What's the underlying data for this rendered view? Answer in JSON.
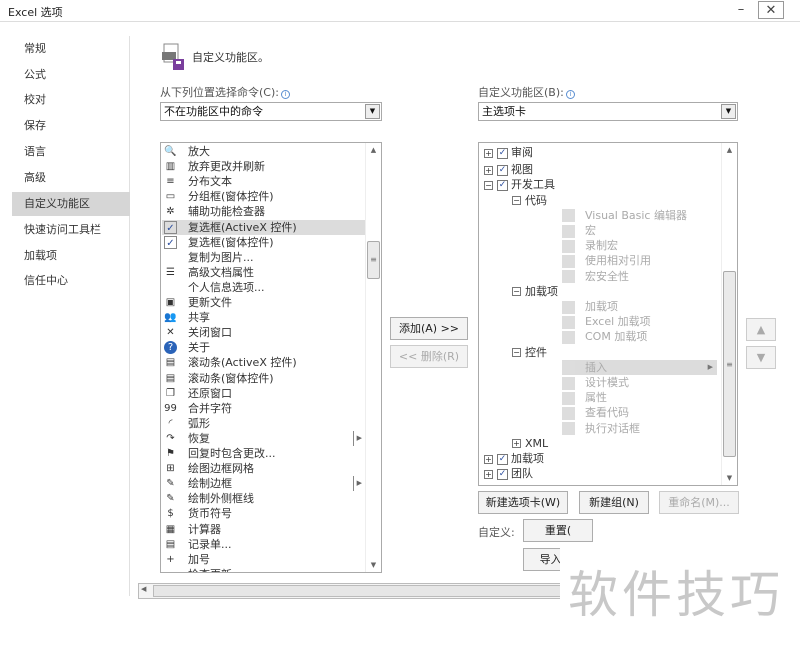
{
  "window": {
    "title": "Excel 选项",
    "minimize": "–",
    "close": "✕"
  },
  "sidebar": {
    "items": [
      {
        "label": "常规"
      },
      {
        "label": "公式"
      },
      {
        "label": "校对"
      },
      {
        "label": "保存"
      },
      {
        "label": "语言"
      },
      {
        "label": "高级"
      },
      {
        "label": "自定义功能区",
        "selected": true
      },
      {
        "label": "快速访问工具栏"
      },
      {
        "label": "加载项"
      },
      {
        "label": "信任中心"
      }
    ]
  },
  "header": {
    "title": "自定义功能区。",
    "icon": "customize-ribbon-icon"
  },
  "left": {
    "label": "从下列位置选择命令(C):",
    "combo_value": "不在功能区中的命令",
    "commands": [
      {
        "label": "放大",
        "icon": "zoom-icon"
      },
      {
        "label": "放弃更改并刷新",
        "icon": "discard-refresh-icon"
      },
      {
        "label": "分布文本",
        "icon": "distribute-text-icon"
      },
      {
        "label": "分组框(窗体控件)",
        "icon": "group-box-icon"
      },
      {
        "label": "辅助功能检查器",
        "icon": "accessibility-icon"
      },
      {
        "label": "复选框(ActiveX 控件)",
        "icon": "checkbox-icon",
        "selected": true
      },
      {
        "label": "复选框(窗体控件)",
        "icon": "checkbox-icon"
      },
      {
        "label": "复制为图片...",
        "icon": ""
      },
      {
        "label": "高级文档属性",
        "icon": "properties-icon"
      },
      {
        "label": "个人信息选项...",
        "icon": ""
      },
      {
        "label": "更新文件",
        "icon": "update-file-icon"
      },
      {
        "label": "共享",
        "icon": "share-icon"
      },
      {
        "label": "关闭窗口",
        "icon": "close-icon"
      },
      {
        "label": "关于",
        "icon": "help-icon"
      },
      {
        "label": "滚动条(ActiveX 控件)",
        "icon": "scrollbar-icon"
      },
      {
        "label": "滚动条(窗体控件)",
        "icon": "scrollbar-icon"
      },
      {
        "label": "还原窗口",
        "icon": "restore-window-icon"
      },
      {
        "label": "合并字符",
        "icon": "combine-chars-icon"
      },
      {
        "label": "弧形",
        "icon": "arc-icon"
      },
      {
        "label": "恢复",
        "icon": "redo-icon",
        "submenu": true
      },
      {
        "label": "回复时包含更改...",
        "icon": "reply-flag-icon"
      },
      {
        "label": "绘图边框网格",
        "icon": "draw-grid-icon"
      },
      {
        "label": "绘制边框",
        "icon": "draw-border-icon",
        "submenu": true
      },
      {
        "label": "绘制外侧框线",
        "icon": "draw-border-icon"
      },
      {
        "label": "货币符号",
        "icon": "currency-icon"
      },
      {
        "label": "计算器",
        "icon": "calculator-icon"
      },
      {
        "label": "记录单...",
        "icon": "form-icon"
      },
      {
        "label": "加号",
        "icon": "plus-icon"
      },
      {
        "label": "检查更新",
        "icon": ""
      }
    ]
  },
  "middle": {
    "add": "添加(A) >>",
    "remove": "<< 删除(R)"
  },
  "right": {
    "label": "自定义功能区(B):",
    "combo_value": "主选项卡",
    "tree": [
      {
        "label": "审阅",
        "level": 0,
        "exp": "+",
        "checked": true
      },
      {
        "label": "视图",
        "level": 0,
        "exp": "+",
        "checked": true
      },
      {
        "label": "开发工具",
        "level": 0,
        "exp": "−",
        "checked": true
      },
      {
        "label": "代码",
        "level": 1,
        "exp": "−"
      },
      {
        "label": "Visual Basic 编辑器",
        "level": 2,
        "disabled": true
      },
      {
        "label": "宏",
        "level": 2,
        "disabled": true
      },
      {
        "label": "录制宏",
        "level": 2,
        "disabled": true
      },
      {
        "label": "使用相对引用",
        "level": 2,
        "disabled": true
      },
      {
        "label": "宏安全性",
        "level": 2,
        "disabled": true
      },
      {
        "label": "加载项",
        "level": 1,
        "exp": "−"
      },
      {
        "label": "加载项",
        "level": 2,
        "disabled": true
      },
      {
        "label": "Excel 加载项",
        "level": 2,
        "disabled": true
      },
      {
        "label": "COM 加载项",
        "level": 2,
        "disabled": true
      },
      {
        "label": "控件",
        "level": 1,
        "exp": "−"
      },
      {
        "label": "插入",
        "level": 2,
        "disabled": true,
        "selected": true,
        "submenu": true
      },
      {
        "label": "设计模式",
        "level": 2,
        "disabled": true
      },
      {
        "label": "属性",
        "level": 2,
        "disabled": true
      },
      {
        "label": "查看代码",
        "level": 2,
        "disabled": true
      },
      {
        "label": "执行对话框",
        "level": 2,
        "disabled": true
      },
      {
        "label": "XML",
        "level": 1,
        "exp": "+"
      },
      {
        "label": "加载项",
        "level": 0,
        "exp": "+",
        "checked": true
      },
      {
        "label": "团队",
        "level": 0,
        "exp": "+",
        "checked": true
      }
    ],
    "new_tab": "新建选项卡(W)",
    "new_group": "新建组(N)",
    "rename": "重命名(M)...",
    "customize_label": "自定义:",
    "reset": "重置(",
    "import_export": "导入/导"
  },
  "watermark": "软件技巧"
}
